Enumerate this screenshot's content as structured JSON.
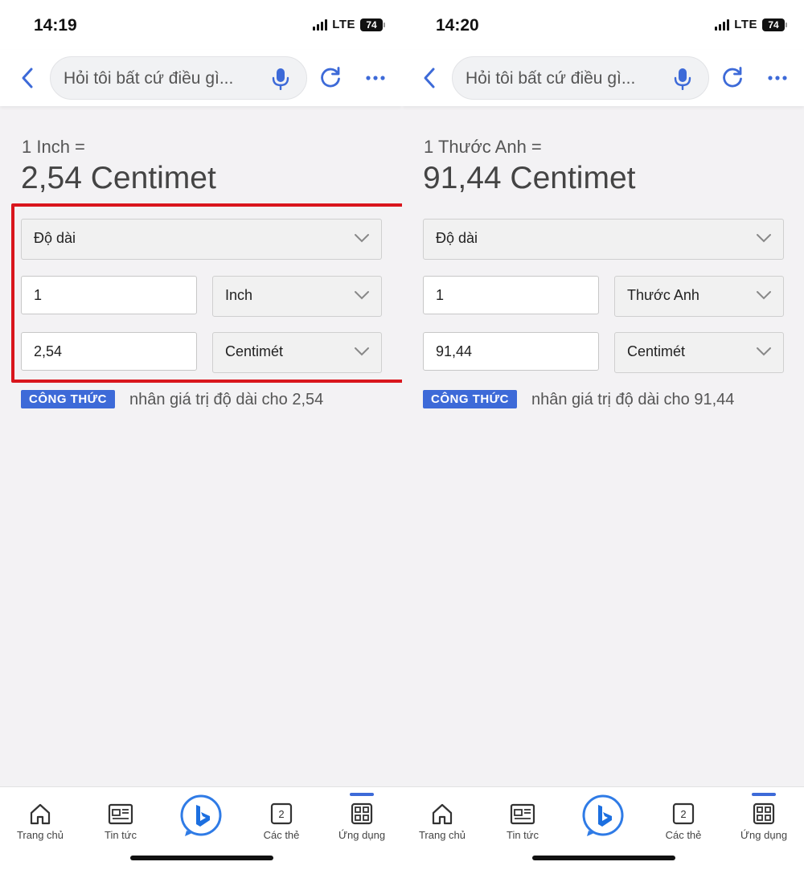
{
  "screens": [
    {
      "status": {
        "time": "14:19",
        "network": "LTE",
        "battery": "74"
      },
      "search": {
        "placeholder": "Hỏi tôi bất cứ điều gì..."
      },
      "result": {
        "label": "1 Inch =",
        "value": "2,54 Centimet"
      },
      "converter": {
        "category": "Độ dài",
        "input_value": "1",
        "input_unit": "Inch",
        "output_value": "2,54",
        "output_unit": "Centimét"
      },
      "formula": {
        "badge": "CÔNG THỨC",
        "text": "nhân giá trị độ dài cho 2,54"
      }
    },
    {
      "status": {
        "time": "14:20",
        "network": "LTE",
        "battery": "74"
      },
      "search": {
        "placeholder": "Hỏi tôi bất cứ điều gì..."
      },
      "result": {
        "label": "1 Thước Anh =",
        "value": "91,44 Centimet"
      },
      "converter": {
        "category": "Độ dài",
        "input_value": "1",
        "input_unit": "Thước Anh",
        "output_value": "91,44",
        "output_unit": "Centimét"
      },
      "formula": {
        "badge": "CÔNG THỨC",
        "text": "nhân giá trị độ dài cho 91,44"
      }
    }
  ],
  "tabbar": [
    {
      "label": "Trang chủ",
      "icon": "home-icon"
    },
    {
      "label": "Tin tức",
      "icon": "news-icon"
    },
    {
      "label": "",
      "icon": "bing-chat-icon"
    },
    {
      "label": "Các thẻ",
      "icon": "tabs-icon",
      "count": "2"
    },
    {
      "label": "Ứng dụng",
      "icon": "apps-icon"
    }
  ],
  "colors": {
    "accent": "#3d6ad8",
    "highlight": "#d9161d",
    "background": "#f3f2f4"
  }
}
